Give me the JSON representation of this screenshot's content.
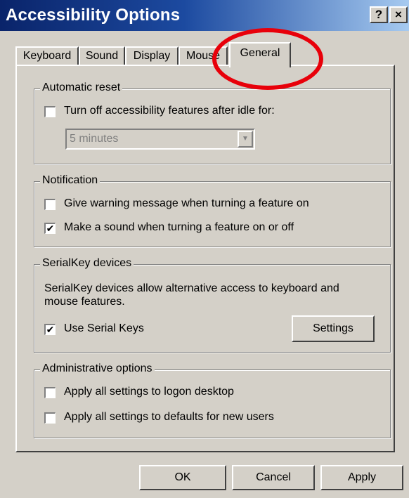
{
  "window": {
    "title": "Accessibility Options",
    "help_label": "?",
    "close_label": "×"
  },
  "tabs": [
    {
      "label": "Keyboard",
      "active": false
    },
    {
      "label": "Sound",
      "active": false
    },
    {
      "label": "Display",
      "active": false
    },
    {
      "label": "Mouse",
      "active": false
    },
    {
      "label": "General",
      "active": true
    }
  ],
  "automatic_reset": {
    "legend": "Automatic reset",
    "turn_off_label": "Turn off accessibility features after idle for:",
    "turn_off_checked": false,
    "idle_select_value": "5 minutes",
    "idle_select_enabled": false
  },
  "notification": {
    "legend": "Notification",
    "warning_label": "Give warning message when turning a feature on",
    "warning_checked": false,
    "sound_label": "Make a sound when turning a feature on or off",
    "sound_checked": true
  },
  "serialkey": {
    "legend": "SerialKey devices",
    "description": "SerialKey devices allow alternative access to keyboard and mouse features.",
    "use_label": "Use Serial Keys",
    "use_checked": true,
    "settings_label": "Settings"
  },
  "administrative": {
    "legend": "Administrative options",
    "logon_label": "Apply all settings to logon desktop",
    "logon_checked": false,
    "new_users_label": "Apply all settings to defaults for new users",
    "new_users_checked": false
  },
  "buttons": {
    "ok_label": "OK",
    "cancel_label": "Cancel",
    "apply_label": "Apply"
  },
  "checkmark_glyph": "✔",
  "dropdown_arrow_glyph": "▼",
  "colors": {
    "title_gradient_start": "#0a246a",
    "title_gradient_end": "#a6caf0",
    "dialog_face": "#d4d0c8",
    "annotation_circle": "#e8000a"
  }
}
